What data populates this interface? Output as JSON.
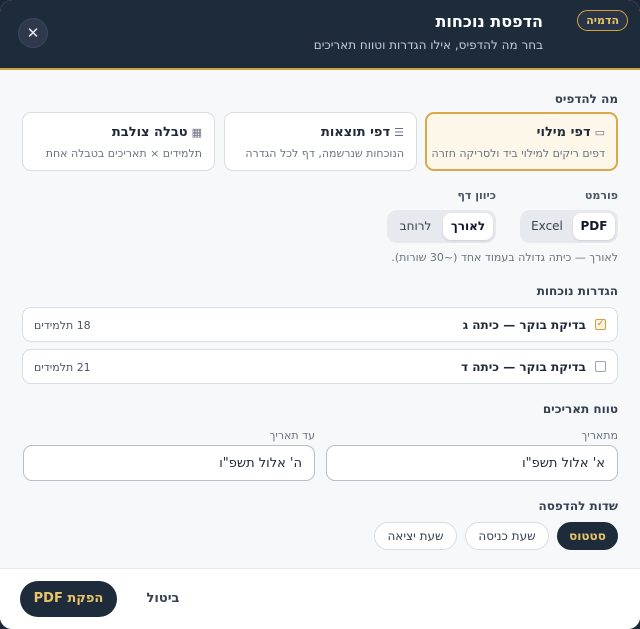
{
  "header": {
    "badge": "הדמיה",
    "title": "הדפסת נוכחות",
    "subtitle": "בחר מה להדפיס, אילו הגדרות וטווח תאריכים",
    "close_icon": "close-icon",
    "close_glyph": "✕"
  },
  "what_to_print": {
    "label": "מה להדפיס",
    "options": [
      {
        "icon": "document-icon",
        "glyph": "▭",
        "title": "דפי מילוי",
        "desc": "דפים ריקים למילוי ביד ולסריקה חזרה",
        "selected": true
      },
      {
        "icon": "list-icon",
        "glyph": "☰",
        "title": "דפי תוצאות",
        "desc": "הנוכחות שנרשמה, דף לכל הגדרה",
        "selected": false
      },
      {
        "icon": "grid-icon",
        "glyph": "▦",
        "title": "טבלה צולבת",
        "desc": "תלמידים × תאריכים בטבלה אחת",
        "selected": false
      }
    ]
  },
  "format": {
    "label": "פורמט",
    "options": [
      "PDF",
      "Excel"
    ],
    "selected": "PDF"
  },
  "orientation": {
    "label": "כיוון דף",
    "options": [
      "לאורך",
      "לרוחב"
    ],
    "selected": "לאורך",
    "hint": "לאורך — כיתה גדולה בעמוד אחד (~30 שורות)."
  },
  "attendance_settings": {
    "label": "הגדרות נוכחות",
    "check_glyph": "✓",
    "items": [
      {
        "label": "בדיקת בוקר — כיתה ג",
        "count": "18 תלמידים",
        "checked": true
      },
      {
        "label": "בדיקת בוקר — כיתה ד",
        "count": "21 תלמידים",
        "checked": false
      }
    ]
  },
  "date_range": {
    "label": "טווח תאריכים",
    "from_label": "מתאריך",
    "from_value": "א' אלול תשפ\"ו",
    "to_label": "עד תאריך",
    "to_value": "ה' אלול תשפ\"ו"
  },
  "print_fields": {
    "label": "שדות להדפסה",
    "options": [
      {
        "label": "סטטוס",
        "active": true
      },
      {
        "label": "שעת כניסה",
        "active": false
      },
      {
        "label": "שעת יציאה",
        "active": false
      }
    ]
  },
  "footer": {
    "primary_label": "הפקת PDF",
    "cancel_label": "ביטול"
  },
  "colors": {
    "header_bg": "#1e2b3b",
    "accent": "#d4a23c",
    "accent_text": "#e8c56a"
  }
}
